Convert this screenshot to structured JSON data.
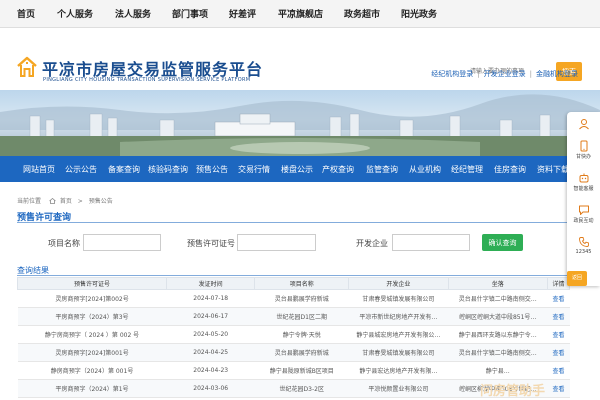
{
  "top_nav": {
    "items": [
      "首页",
      "个人服务",
      "法人服务",
      "部门事项",
      "好差评",
      "平凉旗舰店",
      "政务超市",
      "阳光政务"
    ]
  },
  "header": {
    "title": "平凉市房屋交易监管服务平台",
    "subtitle": "PINGLIANG CITY HOUSING TRANSACTION SUPERVISION SERVICE PLATFORM",
    "search_placeholder": "请输入要办理的事项",
    "search_button": "搜索",
    "login_links": [
      "经纪机构登录",
      "开发企业登录",
      "金融机构登录"
    ]
  },
  "main_nav": {
    "items": [
      "网站首页",
      "公示公告",
      "备案查询",
      "核验码查询",
      "预售公告",
      "交易行情",
      "楼盘公示",
      "产权查询",
      "监管查询",
      "从业机构",
      "经纪管理",
      "佳房查询",
      "资料下载"
    ]
  },
  "breadcrumb": {
    "current_label": "当前位置",
    "items": [
      "首页",
      "预售公告"
    ],
    "separator": ">"
  },
  "section_title": "预售许可查询",
  "search_form": {
    "project_label": "项目名称",
    "project_value": "",
    "permit_label": "预售许可证号",
    "permit_value": "",
    "developer_label": "开发企业",
    "developer_value": "",
    "query_button": "确认查询"
  },
  "results": {
    "title": "查询结果",
    "columns": [
      "预售许可证号",
      "发证时间",
      "项目名称",
      "开发企业",
      "坐落",
      "详情"
    ],
    "rows": [
      [
        "灵房商预字[2024]第002号",
        "2024-07-18",
        "灵台县鹏展学府新城",
        "甘肃春旻城镇发展有限公司",
        "灵台县什字镇二中路南侧交…",
        "查看"
      ],
      [
        "平房商预字（2024）第3号",
        "2024-06-17",
        "世纪花园D1区二期",
        "平凉市新世纪房地产开发有…",
        "崆峒区崆峒大道中段851号…",
        "查看"
      ],
      [
        "静宁房商预字（ 2024 ）第 002 号",
        "2024-05-20",
        "静宁令牌·天悦",
        "静宁县城宏房地产开发有限公…",
        "静宁县西环支路以东静宁令…",
        "查看"
      ],
      [
        "灵房商预字[2024]第001号",
        "2024-04-25",
        "灵台县鹏展学府新城",
        "甘肃春旻城镇发展有限公司",
        "灵台县什字镇二中路南侧交…",
        "查看"
      ],
      [
        "静房商预字（2024）第 001号",
        "2024-04-23",
        "静宁县陇原新城B区项目",
        "静宁县宏达房地产开发有限…",
        "静宁县…",
        "查看"
      ],
      [
        "平房商预字（2024）第1号",
        "2024-03-06",
        "世纪花园D3-2区",
        "平凉悦颜置业有限公司",
        "崆峒区柳湖中路308号世纪…",
        "查看"
      ]
    ]
  },
  "float_bar": {
    "items": [
      "",
      "甘快办",
      "智能客服",
      "政民互动",
      "12345"
    ],
    "back_top": "返回"
  },
  "watermark": "问房管助手",
  "colors": {
    "primary_blue": "#1d67c0",
    "accent_orange": "#f5a623",
    "confirm_green": "#2eae55",
    "title_blue": "#1a4d8f"
  }
}
